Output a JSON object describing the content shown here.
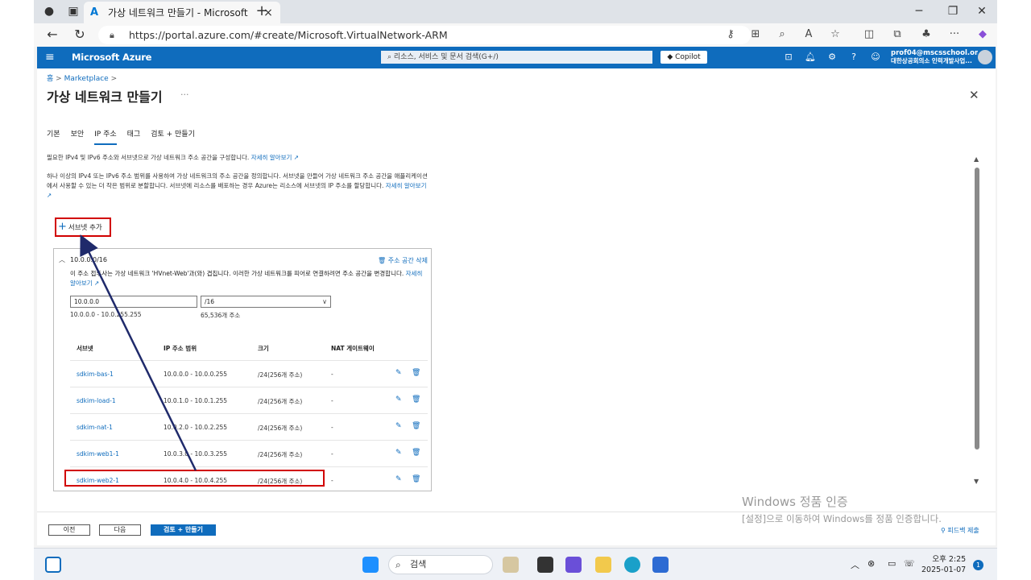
{
  "browser": {
    "tab_title": "가상 네트워크 만들기 - Microsoft",
    "url": "https://portal.azure.com/#create/Microsoft.VirtualNetwork-ARM"
  },
  "portal": {
    "brand": "Microsoft Azure",
    "search_placeholder": "리소스, 서비스 및 문서 검색(G+/)",
    "copilot_label": "Copilot",
    "account_email": "prof04@mscsschool.on...",
    "account_org": "대한상공회의소 인력개발사업..."
  },
  "page": {
    "breadcrumb_home": "홈",
    "breadcrumb_marketplace": "Marketplace",
    "title": "가상 네트워크 만들기",
    "more": "···",
    "tabs": [
      "기본",
      "보안",
      "IP 주소",
      "태그",
      "검토 + 만들기"
    ],
    "active_tab": "IP 주소",
    "intro_text": "필요한 IPv4 및 IPv6 주소와 서브넷으로 가상 네트워크 주소 공간을 구성합니다.",
    "intro_link": "자세히 알아보기",
    "para_text": "하나 이상의 IPv4 또는 IPv6 주소 범위를 사용하여 가상 네트워크의 주소 공간을 정의합니다. 서브넷을 만들어 가상 네트워크 주소 공간을 애플리케이션에서 사용할 수 있는 더 작은 범위로 분할합니다. 서브넷에 리소스를 배포하는 경우 Azure는 리소스에 서브넷의 IP 주소를 할당합니다.",
    "para_link": "자세히 알아보기",
    "add_subnet": "서브넷 추가"
  },
  "address_space": {
    "header": "10.0.0.0/16",
    "delete_label": "주소 공간 삭제",
    "warning_text": "이 주소 접두사는 가상 네트워크 'HVnet-Web'과(와) 겹칩니다. 이러한 가상 네트워크를 피어로 연결하려면 주소 공간을 변경합니다.",
    "warning_link": "자세히 알아보기",
    "address_value": "10.0.0.0",
    "prefix_value": "/16",
    "range_text": "10.0.0.0 - 10.0.255.255",
    "count_text": "65,536개 주소"
  },
  "subnet_table": {
    "headers": [
      "서브넷",
      "IP 주소 범위",
      "크기",
      "NAT 게이트웨이"
    ],
    "rows": [
      {
        "name": "sdkim-bas-1",
        "range": "10.0.0.0 - 10.0.0.255",
        "size": "/24(256개 주소)",
        "nat": "-"
      },
      {
        "name": "sdkim-load-1",
        "range": "10.0.1.0 - 10.0.1.255",
        "size": "/24(256개 주소)",
        "nat": "-"
      },
      {
        "name": "sdkim-nat-1",
        "range": "10.0.2.0 - 10.0.2.255",
        "size": "/24(256개 주소)",
        "nat": "-"
      },
      {
        "name": "sdkim-web1-1",
        "range": "10.0.3.0 - 10.0.3.255",
        "size": "/24(256개 주소)",
        "nat": "-"
      },
      {
        "name": "sdkim-web2-1",
        "range": "10.0.4.0 - 10.0.4.255",
        "size": "/24(256개 주소)",
        "nat": "-"
      }
    ]
  },
  "footer": {
    "prev": "이전",
    "next": "다음",
    "review": "검토 + 만들기",
    "feedback": "피드백 제출"
  },
  "watermark": {
    "line1": "Windows 정품 인증",
    "line2": "[설정]으로 이동하여 Windows를 정품 인증합니다."
  },
  "taskbar": {
    "search": "검색",
    "time": "오후 2:25",
    "date": "2025-01-07",
    "notif_count": "1"
  },
  "colors": {
    "azure_blue": "#0f6cbd",
    "highlight_red": "#d10000",
    "arrow_navy": "#1f2a6b"
  }
}
